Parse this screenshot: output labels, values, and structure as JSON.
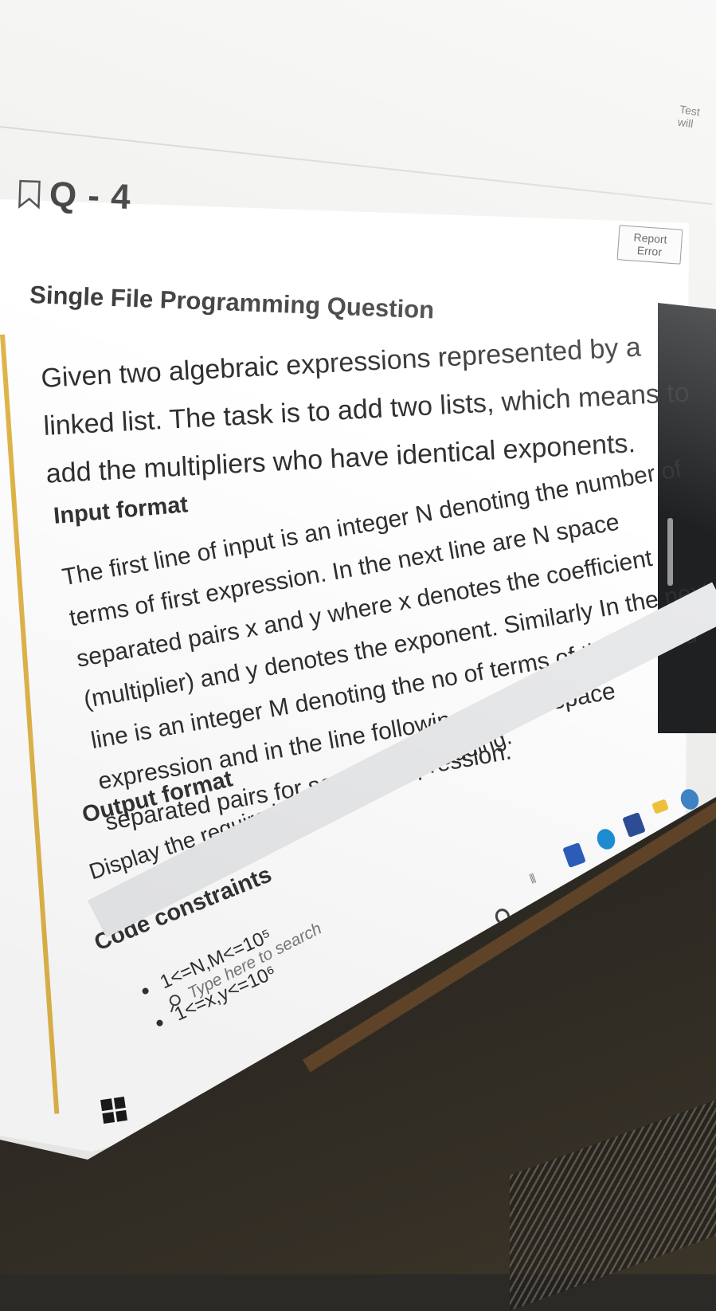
{
  "header": {
    "test_note": "Test will",
    "question_label": "Q - 4",
    "report_button": "Report Error"
  },
  "question": {
    "type": "Single File Programming Question",
    "description": "Given two algebraic expressions represented by a linked list. The task is to add two lists, which means to add the multipliers who have identical exponents.",
    "input_heading": "Input format",
    "input_text": "The first line of input is an integer N denoting the number of terms of first expression. In the next line are N space separated pairs x and y where x denotes the coefficient (multiplier) and y denotes the exponent. Similarly In the next line is an integer M denoting the no of terms of the second expression and in the line following it are N space separated pairs for second expression.",
    "output_heading": "Output format",
    "output_text": "Display the required expression after adding.",
    "constraints_heading": "Code constraints",
    "constraints": [
      "1<=N,M<=10⁵",
      "1<=x,y<=10⁶"
    ]
  },
  "taskbar": {
    "search_placeholder": "Type here to search"
  },
  "icons": {
    "bookmark": "bookmark-icon",
    "windows_start": "windows-start-icon",
    "search": "search-icon"
  }
}
